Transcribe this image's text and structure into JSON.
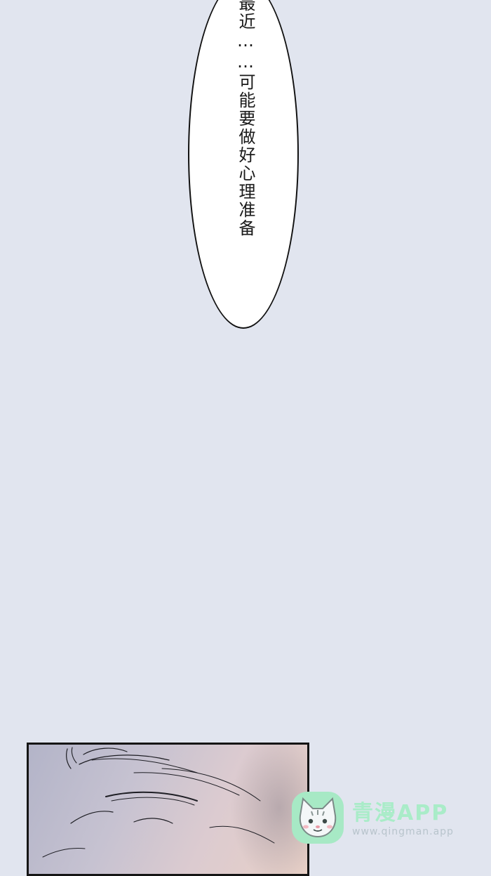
{
  "speech_bubble": {
    "text": "最近……可能要做好心理准备"
  },
  "watermark": {
    "logo_icon": "cat-face-icon",
    "title": "青漫APP",
    "url": "www.qingman.app",
    "accent_color": "#a7e9c5"
  },
  "colors": {
    "page_background": "#e1e5ef",
    "bubble_fill": "#ffffff",
    "bubble_outline": "#111111",
    "panel_border": "#151515"
  }
}
